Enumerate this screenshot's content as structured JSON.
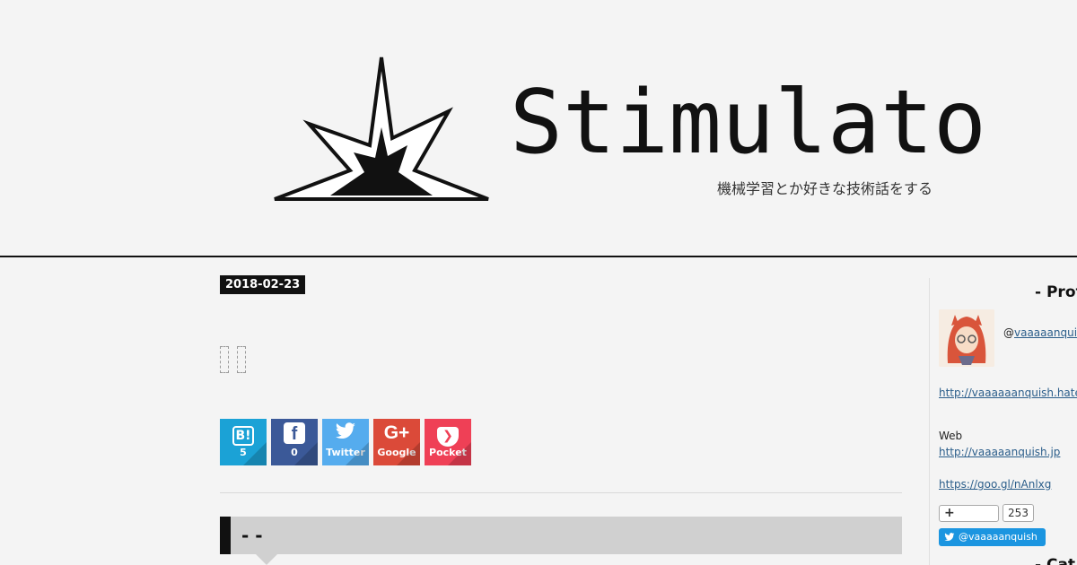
{
  "header": {
    "site_title": "Stimulato",
    "site_description": "機械学習とか好きな技術話をする"
  },
  "entry": {
    "date": "2018-02-23",
    "section_heading": "-  -"
  },
  "share_buttons": [
    {
      "name": "hatena",
      "glyph": "B!",
      "label": "5"
    },
    {
      "name": "facebook",
      "glyph": "f",
      "label": "0"
    },
    {
      "name": "twitter",
      "glyph": "🐦",
      "label": "Twitter"
    },
    {
      "name": "google",
      "glyph": "G+",
      "label": "Google"
    },
    {
      "name": "pocket",
      "glyph": "✓",
      "label": "Pocket"
    }
  ],
  "sidebar": {
    "profile_title": "- Prof",
    "handle_prefix": "@",
    "handle": "vaaaaanquis",
    "blog_link": "http://vaaaaaanquish.hate",
    "web_label": "Web",
    "web_link": "http://vaaaaanquish.jp",
    "short_link": "https://goo.gl/nAnlxg",
    "hatena_add": "+",
    "hatena_count": "253",
    "twitter_follow": "@vaaaaanquish",
    "next_title": "- Cat"
  },
  "colors": {
    "hatena": "#1ba2d6",
    "facebook": "#3b5998",
    "twitter": "#55acee",
    "google": "#db4a39",
    "pocket": "#ef4056",
    "twitter_follow": "#1b95e0"
  }
}
